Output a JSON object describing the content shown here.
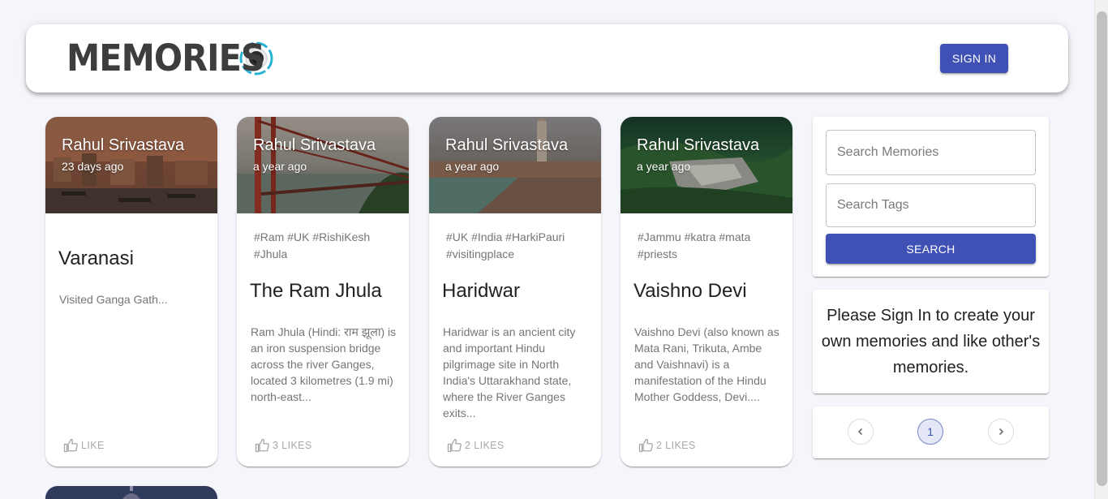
{
  "app": {
    "brand": "MEMORIES",
    "signin_label": "SIGN IN"
  },
  "posts": [
    {
      "author": "Rahul Srivastava",
      "time": "23 days ago",
      "tags": "",
      "title": "Varanasi",
      "message": "Visited Ganga Gath...",
      "likes": "LIKE"
    },
    {
      "author": "Rahul Srivastava",
      "time": "a year ago",
      "tags": "#Ram #UK #RishiKesh #Jhula",
      "title": "The Ram Jhula",
      "message": "Ram Jhula (Hindi: राम झूला) is an iron suspension bridge across the river Ganges, located 3 kilometres (1.9 mi) north-east...",
      "likes": "3 LIKES"
    },
    {
      "author": "Rahul Srivastava",
      "time": "a year ago",
      "tags": "#UK #India #HarkiPauri #visitingplace",
      "title": "Haridwar",
      "message": "Haridwar is an ancient city and important Hindu pilgrimage site in North India's Uttarakhand state, where the River Ganges exits...",
      "likes": "2 LIKES"
    },
    {
      "author": "Rahul Srivastava",
      "time": "a year ago",
      "tags": "#Jammu #katra #mata #priests",
      "title": "Vaishno Devi",
      "message": "Vaishno Devi (also known as Mata Rani, Trikuta, Ambe and Vaishnavi) is a manifestation of the Hindu Mother Goddess, Devi....",
      "likes": "2 LIKES"
    }
  ],
  "search": {
    "memories_placeholder": "Search Memories",
    "tags_placeholder": "Search Tags",
    "button_label": "SEARCH"
  },
  "notice": "Please Sign In to create your own memories and like other's memories.",
  "pagination": {
    "current": "1"
  },
  "colors": {
    "primary": "#3f51b5",
    "background": "#f5f6fb",
    "logo_ring": "#2bb3d6"
  },
  "icons": [
    "camera-lens-logo-icon",
    "thumb-up-icon",
    "chevron-left-icon",
    "chevron-right-icon"
  ]
}
